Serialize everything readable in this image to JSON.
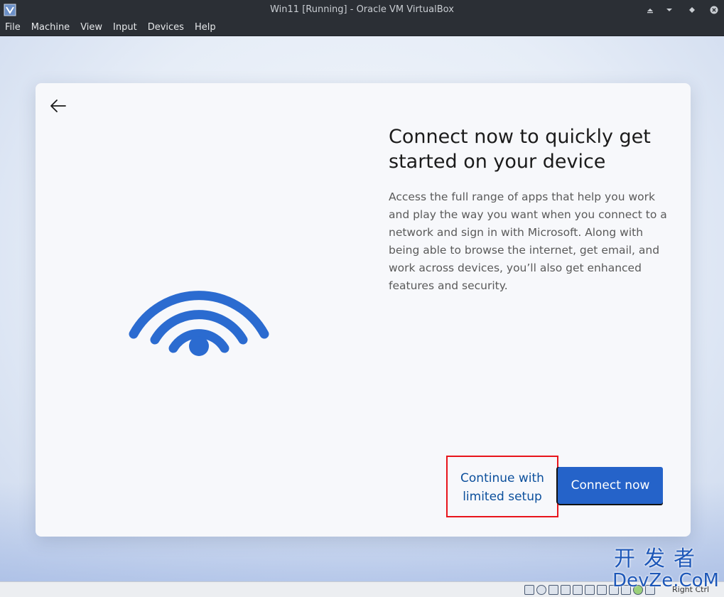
{
  "window": {
    "title": "Win11 [Running] - Oracle VM VirtualBox"
  },
  "menu": {
    "items": [
      "File",
      "Machine",
      "View",
      "Input",
      "Devices",
      "Help"
    ]
  },
  "setup": {
    "headline": "Connect now to quickly get started on your device",
    "body": "Access the full range of apps that help you work and play the way you want when you connect to a network and sign in with Microsoft. Along with being able to browse the internet, get email, and work across devices, you’ll also get enhanced features and security.",
    "limited_setup_label": "Continue with\nlimited setup",
    "connect_now_label": "Connect now"
  },
  "watermark": {
    "cn": "开发者",
    "en": "DevZe.CoM"
  },
  "statusbar": {
    "host_key": "Right Ctrl"
  },
  "colors": {
    "accent": "#2563c9",
    "link": "#0b4f9c",
    "highlight": "#e8141b",
    "wifi": "#2b6bd0"
  }
}
